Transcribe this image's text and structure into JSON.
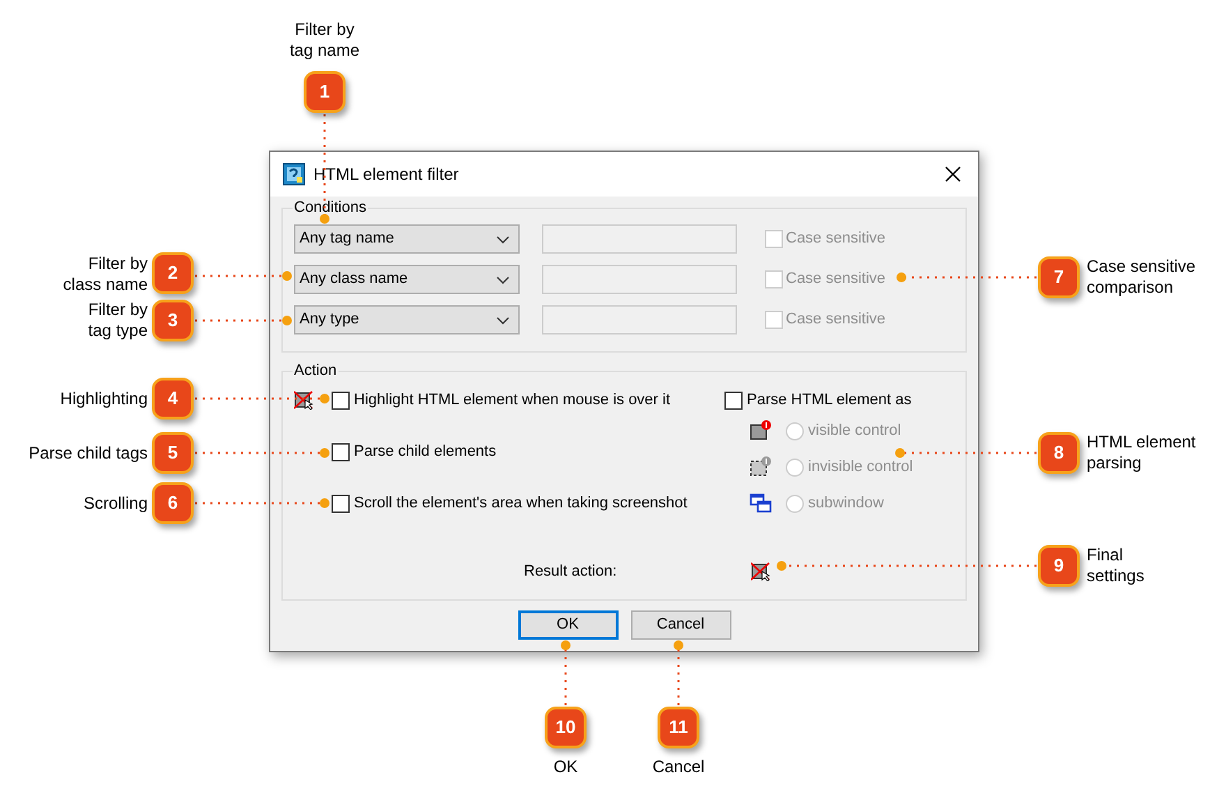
{
  "callouts": [
    {
      "number": "1",
      "label": "Filter by\ntag name"
    },
    {
      "number": "2",
      "label": "Filter by\nclass name"
    },
    {
      "number": "3",
      "label": "Filter by\ntag type"
    },
    {
      "number": "4",
      "label": "Highlighting"
    },
    {
      "number": "5",
      "label": "Parse child tags"
    },
    {
      "number": "6",
      "label": "Scrolling"
    },
    {
      "number": "7",
      "label": "Case sensitive\ncomparison"
    },
    {
      "number": "8",
      "label": "HTML element\nparsing"
    },
    {
      "number": "9",
      "label": "Final\nsettings"
    },
    {
      "number": "10",
      "label": "OK"
    },
    {
      "number": "11",
      "label": "Cancel"
    }
  ],
  "dialog": {
    "title": "HTML element filter",
    "conditions": {
      "title": "Conditions",
      "rows": [
        {
          "selector": "Any tag name",
          "case_sensitive": {
            "label": "Case sensitive",
            "checked": false,
            "disabled": true
          }
        },
        {
          "selector": "Any class name",
          "case_sensitive": {
            "label": "Case sensitive",
            "checked": false,
            "disabled": true
          }
        },
        {
          "selector": "Any type",
          "case_sensitive": {
            "label": "Case sensitive",
            "checked": false,
            "disabled": true
          }
        }
      ]
    },
    "action": {
      "title": "Action",
      "options": [
        {
          "label": "Highlight HTML element when mouse is over it",
          "checked": false
        },
        {
          "label": "Parse child elements",
          "checked": false
        },
        {
          "label": "Scroll the element's area when taking screenshot",
          "checked": false
        }
      ],
      "parse_as": {
        "label": "Parse HTML element as",
        "checked": false,
        "choices": [
          {
            "kind": "visible",
            "label": "visible control",
            "selected": false,
            "disabled": true
          },
          {
            "kind": "invisible",
            "label": "invisible control",
            "selected": false,
            "disabled": true
          },
          {
            "kind": "subwindow",
            "label": "subwindow",
            "selected": false,
            "disabled": true
          }
        ]
      },
      "result_label": "Result action:"
    },
    "buttons": [
      {
        "label": "OK",
        "default": true
      },
      {
        "label": "Cancel",
        "default": false
      }
    ]
  }
}
